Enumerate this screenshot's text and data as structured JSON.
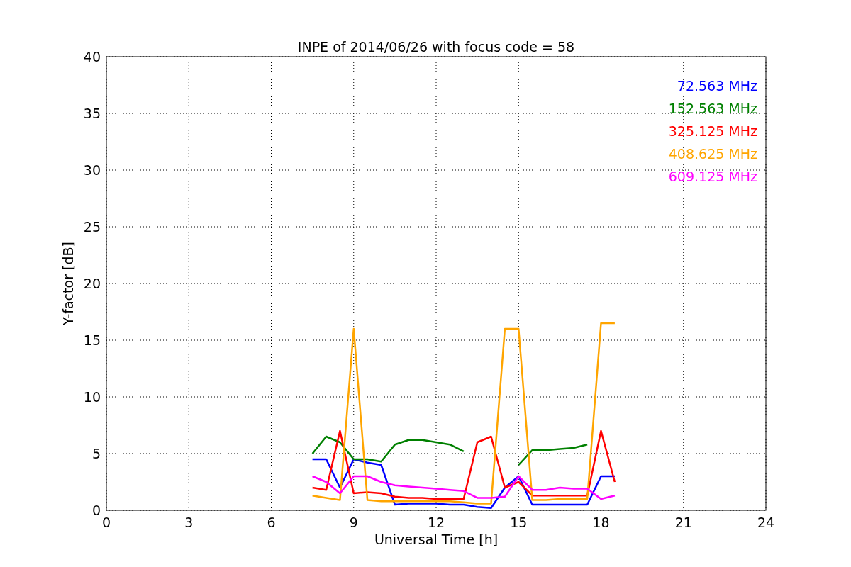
{
  "figure": {
    "chart_data": {
      "type": "line",
      "title": "INPE of 2014/06/26 with focus code = 58",
      "xlabel": "Universal Time [h]",
      "ylabel": "Y-factor [dB]",
      "x": [
        7.5,
        8,
        8.5,
        9,
        9.5,
        10,
        10.5,
        11,
        11.5,
        12,
        12.5,
        13,
        13.5,
        14,
        14.5,
        15,
        15.5,
        16,
        16.5,
        17,
        17.5,
        18,
        18.5
      ],
      "grid": true,
      "xlim": [
        0,
        24
      ],
      "ylim": [
        0,
        40
      ],
      "xticks": [
        0,
        3,
        6,
        9,
        12,
        15,
        18,
        21,
        24
      ],
      "yticks": [
        0,
        5,
        10,
        15,
        20,
        25,
        30,
        35,
        40
      ],
      "series": [
        {
          "name": "72.563 MHz",
          "color": "#0000ff",
          "values": [
            4.5,
            4.5,
            2,
            4.5,
            4.2,
            4,
            0.5,
            0.6,
            0.6,
            0.6,
            0.5,
            0.5,
            0.3,
            0.2,
            2,
            3,
            0.5,
            0.5,
            0.5,
            0.5,
            0.5,
            3,
            3
          ]
        },
        {
          "name": "152.563 MHz",
          "color": "#008000",
          "values": [
            5,
            6.5,
            6,
            4.5,
            4.5,
            4.3,
            5.8,
            6.2,
            6.2,
            6,
            5.8,
            5.2,
            null,
            null,
            null,
            4,
            5.3,
            5.3,
            5.4,
            5.5,
            5.8,
            null,
            null
          ]
        },
        {
          "name": "325.125 MHz",
          "color": "#ff0000",
          "values": [
            2,
            1.8,
            7,
            1.5,
            1.6,
            1.5,
            1.2,
            1.1,
            1.1,
            1,
            1,
            1,
            6,
            6.5,
            2,
            2.5,
            1.3,
            1.3,
            1.3,
            1.3,
            1.3,
            7,
            2.5
          ]
        },
        {
          "name": "408.625 MHz",
          "color": "#ffa500",
          "values": [
            1.3,
            1.1,
            0.9,
            16,
            0.9,
            0.8,
            0.8,
            0.8,
            0.8,
            0.8,
            0.8,
            0.7,
            0.6,
            0.6,
            16,
            16,
            0.9,
            0.9,
            1,
            1,
            1,
            16.5,
            16.5
          ]
        },
        {
          "name": "609.125 MHz",
          "color": "#ff00ff",
          "values": [
            3,
            2.5,
            1.5,
            3,
            3,
            2.5,
            2.2,
            2.1,
            2,
            1.9,
            1.8,
            1.7,
            1.1,
            1.1,
            1.2,
            3,
            1.8,
            1.8,
            2,
            1.9,
            1.9,
            1,
            1.3
          ]
        }
      ]
    }
  }
}
